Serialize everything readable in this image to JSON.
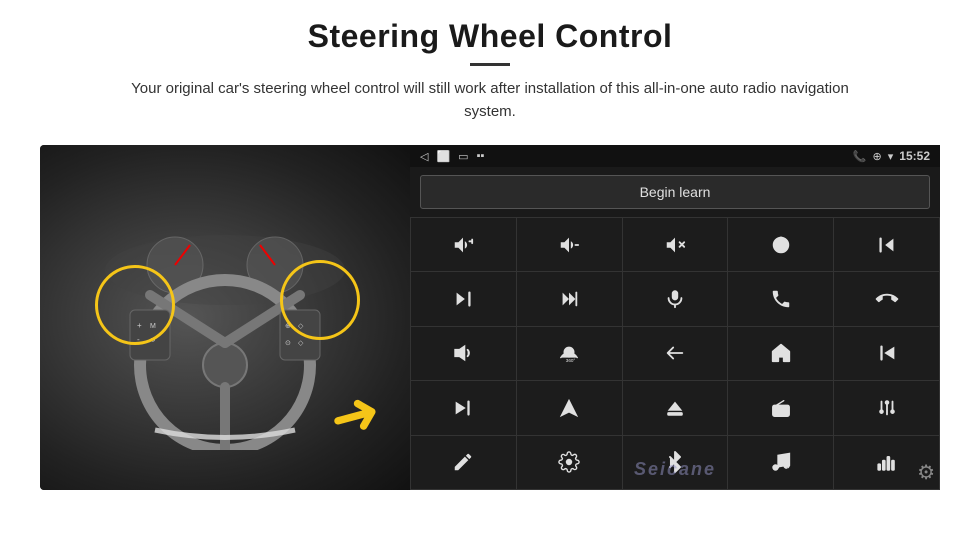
{
  "header": {
    "title": "Steering Wheel Control",
    "divider": true,
    "subtitle": "Your original car's steering wheel control will still work after installation of this all-in-one auto radio navigation system."
  },
  "android_ui": {
    "status_bar": {
      "back_icon": "◁",
      "home_icon": "⬜",
      "recents_icon": "▭",
      "signal_icon": "▪▪",
      "phone_icon": "📞",
      "location_icon": "⊕",
      "wifi_icon": "▾",
      "time": "15:52"
    },
    "begin_learn_label": "Begin learn",
    "control_buttons": [
      {
        "id": "vol-up",
        "icon": "vol_up"
      },
      {
        "id": "vol-down",
        "icon": "vol_down"
      },
      {
        "id": "vol-mute",
        "icon": "vol_mute"
      },
      {
        "id": "power",
        "icon": "power"
      },
      {
        "id": "prev-track",
        "icon": "prev_track"
      },
      {
        "id": "next-track",
        "icon": "next_track"
      },
      {
        "id": "ff",
        "icon": "ff"
      },
      {
        "id": "mic",
        "icon": "mic"
      },
      {
        "id": "phone",
        "icon": "phone"
      },
      {
        "id": "hang-up",
        "icon": "hang_up"
      },
      {
        "id": "horn",
        "icon": "horn"
      },
      {
        "id": "360",
        "icon": "360"
      },
      {
        "id": "back",
        "icon": "back"
      },
      {
        "id": "home",
        "icon": "home"
      },
      {
        "id": "prev-chapter",
        "icon": "prev_chapter"
      },
      {
        "id": "fast-fwd",
        "icon": "fast_fwd"
      },
      {
        "id": "nav",
        "icon": "nav"
      },
      {
        "id": "eject",
        "icon": "eject"
      },
      {
        "id": "radio",
        "icon": "radio"
      },
      {
        "id": "eq",
        "icon": "eq"
      },
      {
        "id": "pen",
        "icon": "pen"
      },
      {
        "id": "settings2",
        "icon": "settings2"
      },
      {
        "id": "bluetooth",
        "icon": "bluetooth"
      },
      {
        "id": "music",
        "icon": "music"
      },
      {
        "id": "spectrum",
        "icon": "spectrum"
      }
    ],
    "watermark": "Seicane",
    "gear_icon": "⚙"
  },
  "colors": {
    "accent": "#f5c518",
    "background": "#ffffff",
    "panel_bg": "#1a1a1a",
    "button_bg": "#1c1c1c",
    "text": "#e0e0e0"
  }
}
